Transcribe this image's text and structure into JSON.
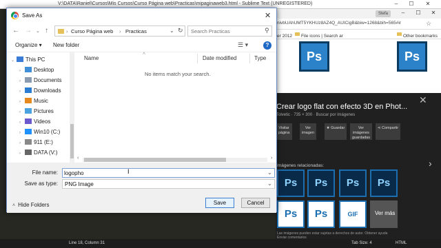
{
  "sublime": {
    "title": "V:\\DATA\\Raniel\\Cursos\\Mis Cursos\\Curso Página web\\Practicas\\mipaginaweb3.html - Sublime Text (UNREGISTERED)",
    "status_left": "Line 18, Column 31",
    "status_tab": "Tab Size: 4",
    "status_syntax": "HTML"
  },
  "chrome": {
    "badge": "Stefa",
    "url": "nivbUAhUMT5YKHUz8AZ4Q_AUICigB&biw=1268&bih=565#ir",
    "bookmarks": [
      {
        "label": "er 2012"
      },
      {
        "label": "File icons | Search ar"
      },
      {
        "label": "Other bookmarks"
      }
    ],
    "preview_title": "Crear logo flat con efecto 3D en Phot...",
    "preview_sub": "Tolvetic · 735 × 300 · Buscar por imágenes",
    "actions": [
      {
        "label": "Visitar\npágina"
      },
      {
        "label": "Ver\nimagen"
      },
      {
        "label": "★ Guardar"
      },
      {
        "label": "Ver\nimágenes\nguardadas"
      },
      {
        "label": "⋖ Compartir"
      }
    ],
    "related_label": "Imágenes relacionadas:",
    "tile_text": "Ps",
    "tile_labels": [
      "Ps",
      "Ps",
      "GIF"
    ],
    "ver_mas": "Ver más",
    "note_line1": "Las imágenes pueden estar sujetas a derechos de autor.   Obtener ayuda",
    "note_line2": "Enviar comentarios"
  },
  "dialog": {
    "title": "Save As",
    "close_glyph": "✕",
    "breadcrumb": [
      "Curso Página web",
      "Practicas"
    ],
    "search_placeholder": "Search Practicas",
    "organize_label": "Organize ▾",
    "new_folder_label": "New folder",
    "sidebar": [
      {
        "label": "This PC",
        "icon": "computer-icon",
        "color": "#3a7bd5"
      },
      {
        "label": "Desktop",
        "icon": "desktop-folder-icon",
        "color": "#3f8fd8"
      },
      {
        "label": "Documents",
        "icon": "documents-folder-icon",
        "color": "#8a9bb0"
      },
      {
        "label": "Downloads",
        "icon": "downloads-folder-icon",
        "color": "#2a7dd1"
      },
      {
        "label": "Music",
        "icon": "music-folder-icon",
        "color": "#e68a1f"
      },
      {
        "label": "Pictures",
        "icon": "pictures-folder-icon",
        "color": "#4aa3e0"
      },
      {
        "label": "Videos",
        "icon": "videos-folder-icon",
        "color": "#6a5acd"
      },
      {
        "label": "Win10 (C:)",
        "icon": "windows-drive-icon",
        "color": "#1e90ff"
      },
      {
        "label": "911 (E:)",
        "icon": "drive-icon",
        "color": "#888888"
      },
      {
        "label": "DATA (V:)",
        "icon": "drive-icon",
        "color": "#666666"
      }
    ],
    "columns": [
      "Name",
      "Date modified",
      "Type"
    ],
    "empty_message": "No items match your search.",
    "file_name_label": "File name:",
    "file_name_value": "logopho",
    "save_type_label": "Save as type:",
    "save_type_value": "PNG Image",
    "hide_folders_label": "Hide Folders",
    "save_label": "Save",
    "cancel_label": "Cancel"
  }
}
